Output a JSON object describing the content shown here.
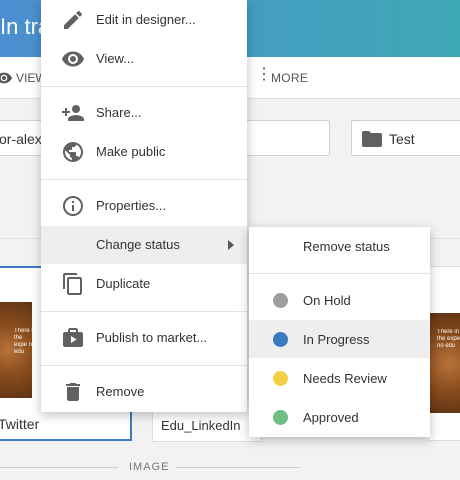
{
  "app": {
    "title_fragment": "In tra",
    "toolbar": {
      "view_label": "VIEW",
      "more_label": "MORE"
    },
    "field_left_value": "or-alex-",
    "field_right_value": "Test",
    "cards": [
      {
        "label": "Twitter",
        "thumb_text": "There in the expe no edu"
      },
      {
        "label": "Edu_LinkedIn"
      },
      {
        "thumb_text": "There in the expe no edu"
      }
    ],
    "section_label": "IMAGE"
  },
  "context_menu": {
    "items": [
      {
        "label": "Edit in designer...",
        "icon": "pencil-icon"
      },
      {
        "label": "View...",
        "icon": "eye-icon"
      },
      {
        "label": "Share...",
        "icon": "add-person-icon"
      },
      {
        "label": "Make public",
        "icon": "globe-icon"
      },
      {
        "label": "Properties...",
        "icon": "info-icon"
      },
      {
        "label": "Change status",
        "icon": "",
        "has_submenu": true,
        "active": true
      },
      {
        "label": "Duplicate",
        "icon": "copy-icon"
      },
      {
        "label": "Publish to market...",
        "icon": "publish-icon"
      },
      {
        "label": "Remove",
        "icon": "trash-icon"
      }
    ]
  },
  "status_submenu": {
    "remove_label": "Remove status",
    "items": [
      {
        "label": "On Hold",
        "color": "#9e9e9e"
      },
      {
        "label": "In Progress",
        "color": "#3a7abf",
        "active": true
      },
      {
        "label": "Needs Review",
        "color": "#f2cf44"
      },
      {
        "label": "Approved",
        "color": "#6dbf84"
      }
    ]
  }
}
